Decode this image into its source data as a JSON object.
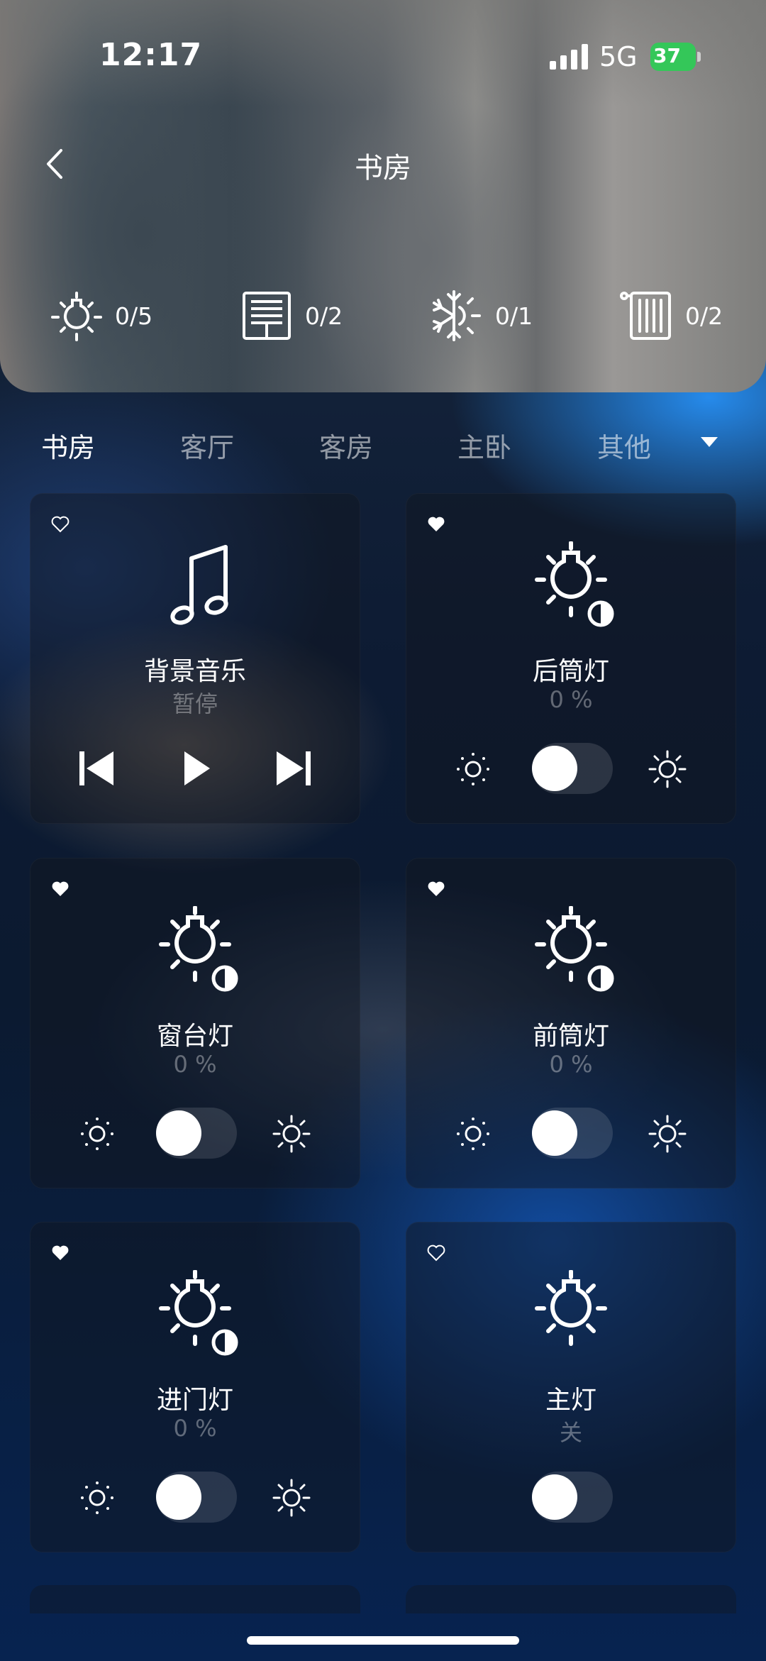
{
  "status_bar": {
    "time": "12:17",
    "network": "5G",
    "battery": "37"
  },
  "nav": {
    "title": "书房"
  },
  "summary": [
    {
      "icon": "light-bulb-icon",
      "count": "0/5"
    },
    {
      "icon": "curtain-icon",
      "count": "0/2"
    },
    {
      "icon": "air-conditioner-icon",
      "count": "0/1"
    },
    {
      "icon": "heater-icon",
      "count": "0/2"
    }
  ],
  "tabs": [
    {
      "label": "书房",
      "active": true
    },
    {
      "label": "客厅",
      "active": false
    },
    {
      "label": "客房",
      "active": false
    },
    {
      "label": "主卧",
      "active": false
    },
    {
      "label": "其他",
      "active": false
    }
  ],
  "devices": [
    {
      "name": "背景音乐",
      "state": "暂停",
      "type": "music",
      "favorite": false,
      "icon": "music-note-icon"
    },
    {
      "name": "后筒灯",
      "state": "0 %",
      "type": "dimmer",
      "favorite": true,
      "icon": "dimmable-light-icon",
      "level": 0
    },
    {
      "name": "窗台灯",
      "state": "0 %",
      "type": "dimmer",
      "favorite": true,
      "icon": "dimmable-light-icon",
      "level": 0
    },
    {
      "name": "前筒灯",
      "state": "0 %",
      "type": "dimmer",
      "favorite": true,
      "icon": "dimmable-light-icon",
      "level": 0
    },
    {
      "name": "进门灯",
      "state": "0 %",
      "type": "dimmer",
      "favorite": true,
      "icon": "dimmable-light-icon",
      "level": 0
    },
    {
      "name": "主灯",
      "state": "关",
      "type": "switch",
      "favorite": false,
      "icon": "light-bulb-icon",
      "on": false
    }
  ],
  "colors": {
    "battery": "#34c759",
    "accent": "#2d8cff"
  }
}
